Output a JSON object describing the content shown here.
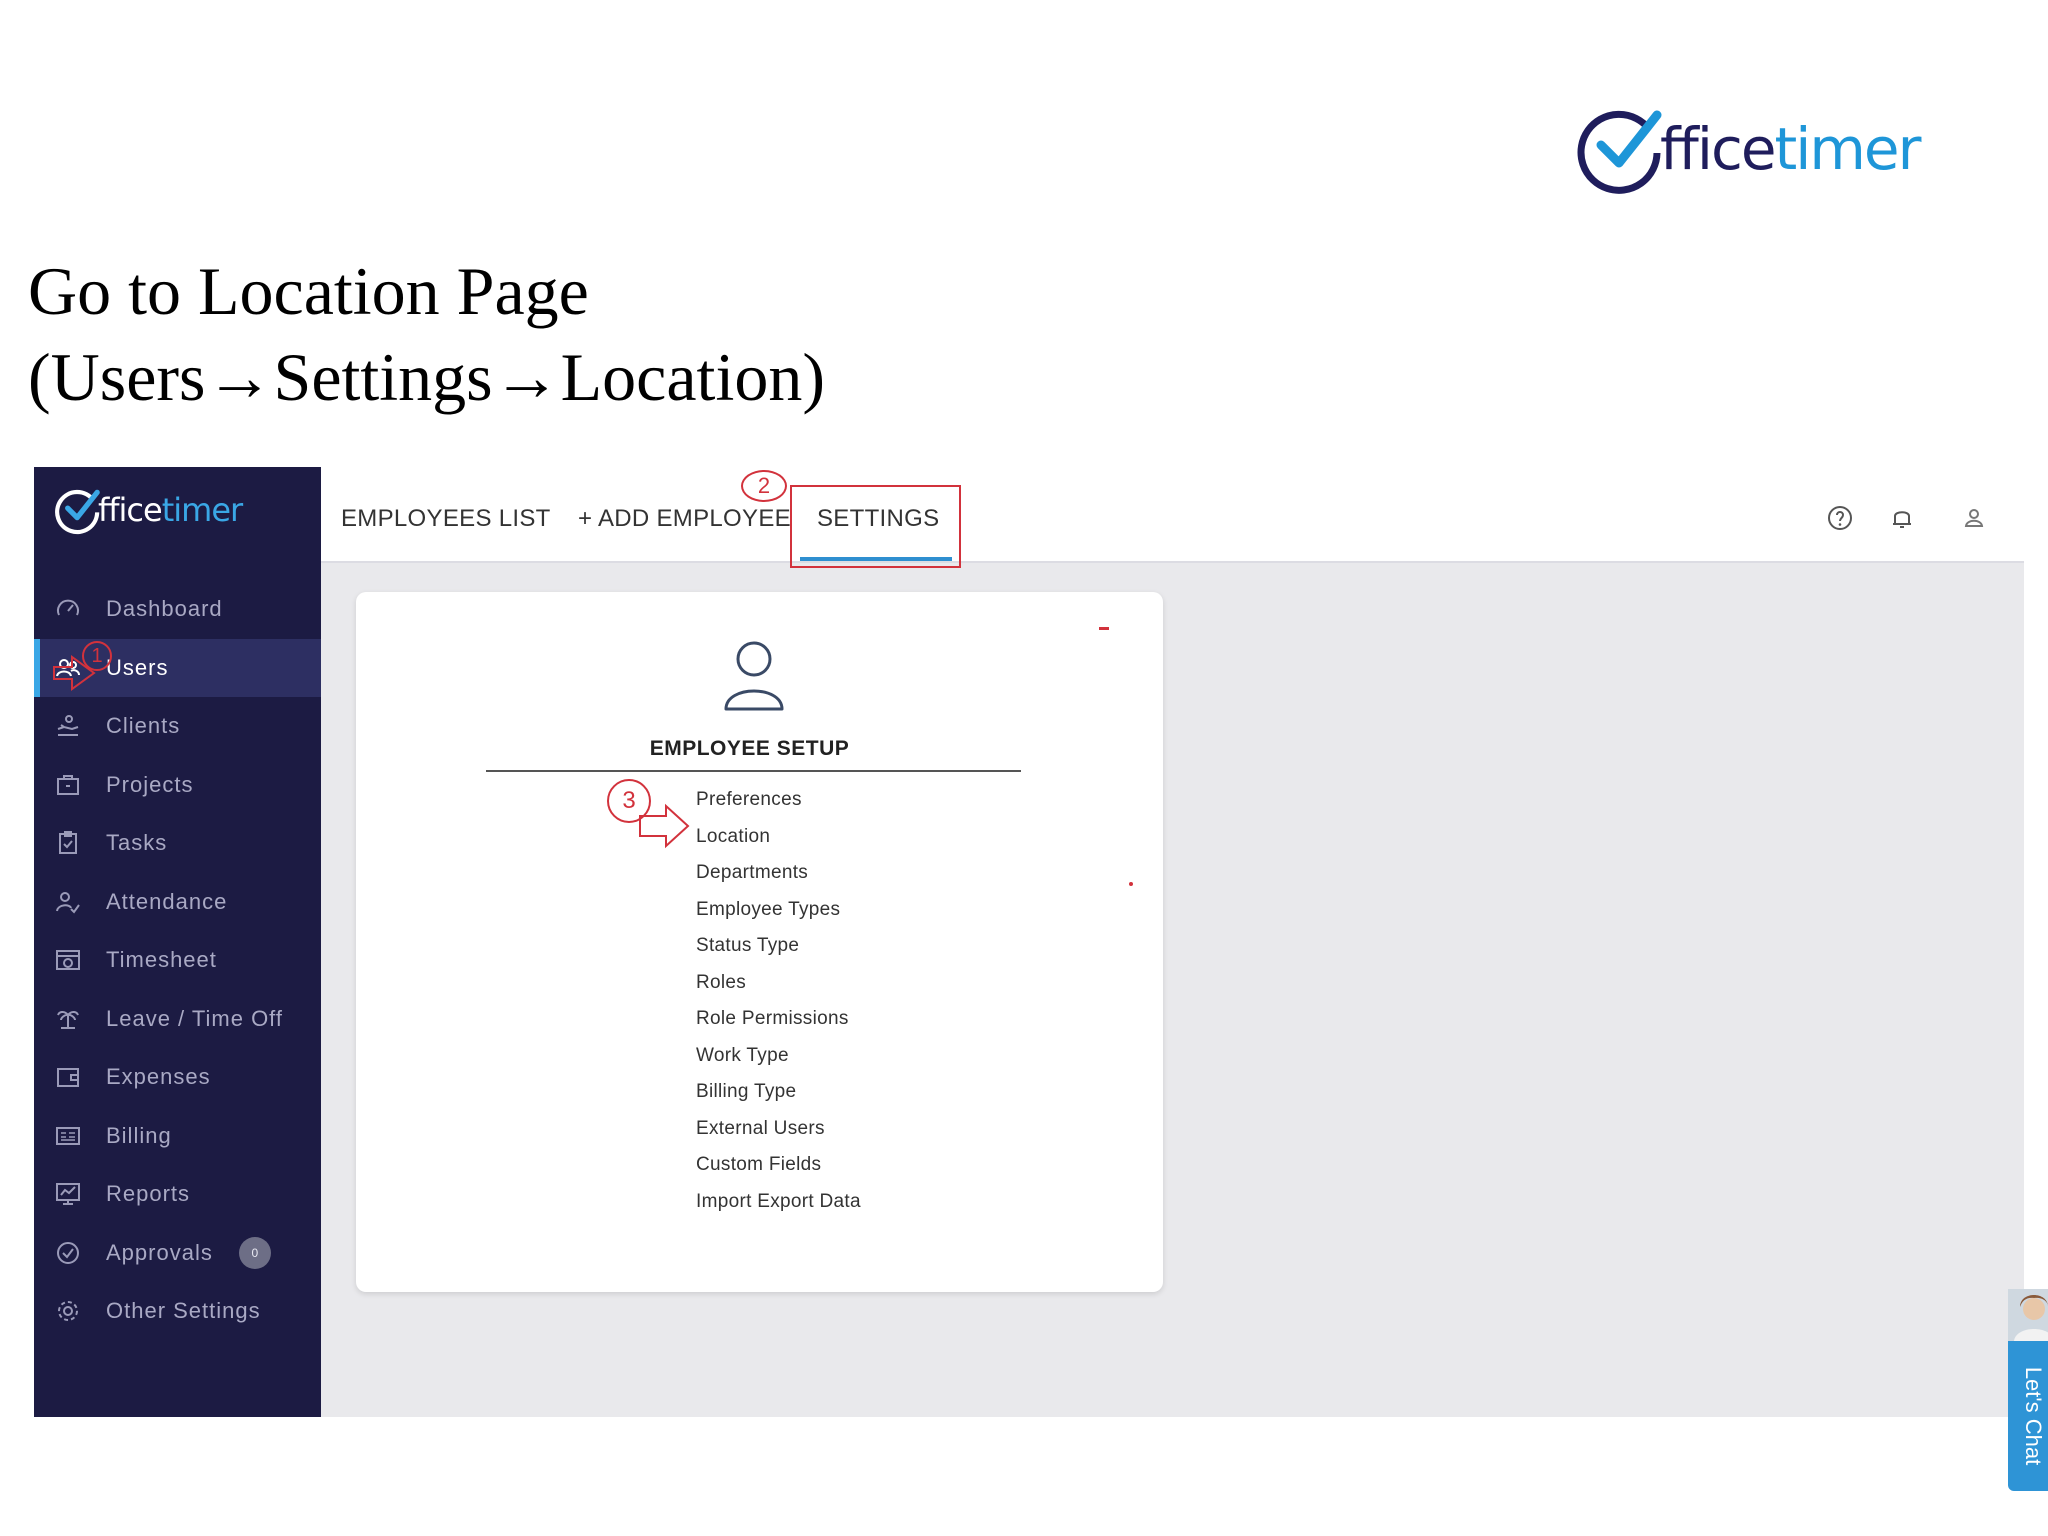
{
  "slide": {
    "logo": {
      "part1": "ffice",
      "part2": "timer"
    },
    "title_line1": "Go to Location Page",
    "title_line2": "(Users→Settings→Location)"
  },
  "app": {
    "logo": {
      "part1": "ffice",
      "part2": "timer"
    },
    "sidebar": {
      "items": [
        {
          "label": "Dashboard",
          "icon": "dashboard-gauge-icon"
        },
        {
          "label": "Users",
          "icon": "users-icon",
          "active": true
        },
        {
          "label": "Clients",
          "icon": "clients-icon"
        },
        {
          "label": "Projects",
          "icon": "briefcase-icon"
        },
        {
          "label": "Tasks",
          "icon": "clipboard-icon"
        },
        {
          "label": "Attendance",
          "icon": "attendance-user-check-icon"
        },
        {
          "label": "Timesheet",
          "icon": "calendar-clock-icon"
        },
        {
          "label": "Leave / Time Off",
          "icon": "palm-tree-icon"
        },
        {
          "label": "Expenses",
          "icon": "wallet-icon"
        },
        {
          "label": "Billing",
          "icon": "invoice-icon"
        },
        {
          "label": "Reports",
          "icon": "chart-board-icon"
        },
        {
          "label": "Approvals",
          "icon": "check-circle-icon",
          "badge": "0"
        },
        {
          "label": "Other Settings",
          "icon": "gear-icon"
        }
      ]
    },
    "tabs": {
      "employees_list": "EMPLOYEES LIST",
      "add_employee": "+ ADD EMPLOYEE",
      "settings": "SETTINGS"
    },
    "top_icons": [
      "help-circle-icon",
      "bell-icon",
      "user-icon"
    ],
    "card": {
      "icon": "person-outline-icon",
      "title": "EMPLOYEE SETUP",
      "items": [
        "Preferences",
        "Location",
        "Departments",
        "Employee Types",
        "Status Type",
        "Roles",
        "Role Permissions",
        "Work Type",
        "Billing Type",
        "External Users",
        "Custom Fields",
        "Import Export Data"
      ]
    },
    "chat": {
      "label": "Let's Chat"
    },
    "annotations": {
      "step1": "1",
      "step2": "2",
      "step3": "3"
    },
    "colors": {
      "sidebar_bg": "#1c1b43",
      "active_item": "#2d2f62",
      "accent_blue": "#2f8fd0",
      "annotation_red": "#d2323c"
    }
  }
}
